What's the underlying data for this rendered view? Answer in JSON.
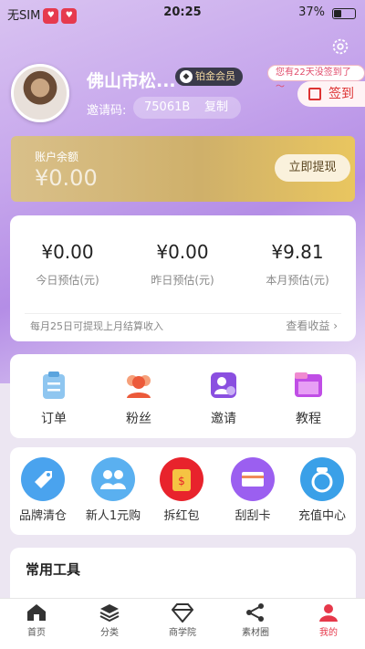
{
  "status": {
    "carrier": "无SIM",
    "time": "20:25",
    "battery": "37%"
  },
  "profile": {
    "name": "佛山市松...",
    "vip_badge": "铂金会员",
    "invite_label": "邀请码:",
    "invite_code": "75061B",
    "copy_label": "复制"
  },
  "sign": {
    "tip": "您有22天没签到了～",
    "button": "签到"
  },
  "balance": {
    "label": "账户余额",
    "amount": "¥0.00",
    "withdraw": "立即提现"
  },
  "earnings": {
    "items": [
      {
        "value": "¥0.00",
        "label": "今日预估(元)"
      },
      {
        "value": "¥0.00",
        "label": "昨日预估(元)"
      },
      {
        "value": "¥9.81",
        "label": "本月预估(元)"
      }
    ],
    "note": "每月25日可提现上月结算收入",
    "view": "查看收益 ›"
  },
  "grid1": [
    {
      "label": "订单",
      "icon": "order-icon"
    },
    {
      "label": "粉丝",
      "icon": "fans-icon"
    },
    {
      "label": "邀请",
      "icon": "invite-icon"
    },
    {
      "label": "教程",
      "icon": "tutorial-icon"
    }
  ],
  "grid2": [
    {
      "label": "品牌清仓",
      "icon": "tag-icon"
    },
    {
      "label": "新人1元购",
      "icon": "people-icon"
    },
    {
      "label": "拆红包",
      "icon": "redpacket-icon"
    },
    {
      "label": "刮刮卡",
      "icon": "card-icon"
    },
    {
      "label": "充值中心",
      "icon": "recharge-icon"
    }
  ],
  "tools": {
    "title": "常用工具"
  },
  "nav": [
    {
      "label": "首页",
      "icon": "home-icon"
    },
    {
      "label": "分类",
      "icon": "category-icon"
    },
    {
      "label": "商学院",
      "icon": "diamond-icon"
    },
    {
      "label": "素材圈",
      "icon": "share-icon"
    },
    {
      "label": "我的",
      "icon": "profile-icon"
    }
  ]
}
